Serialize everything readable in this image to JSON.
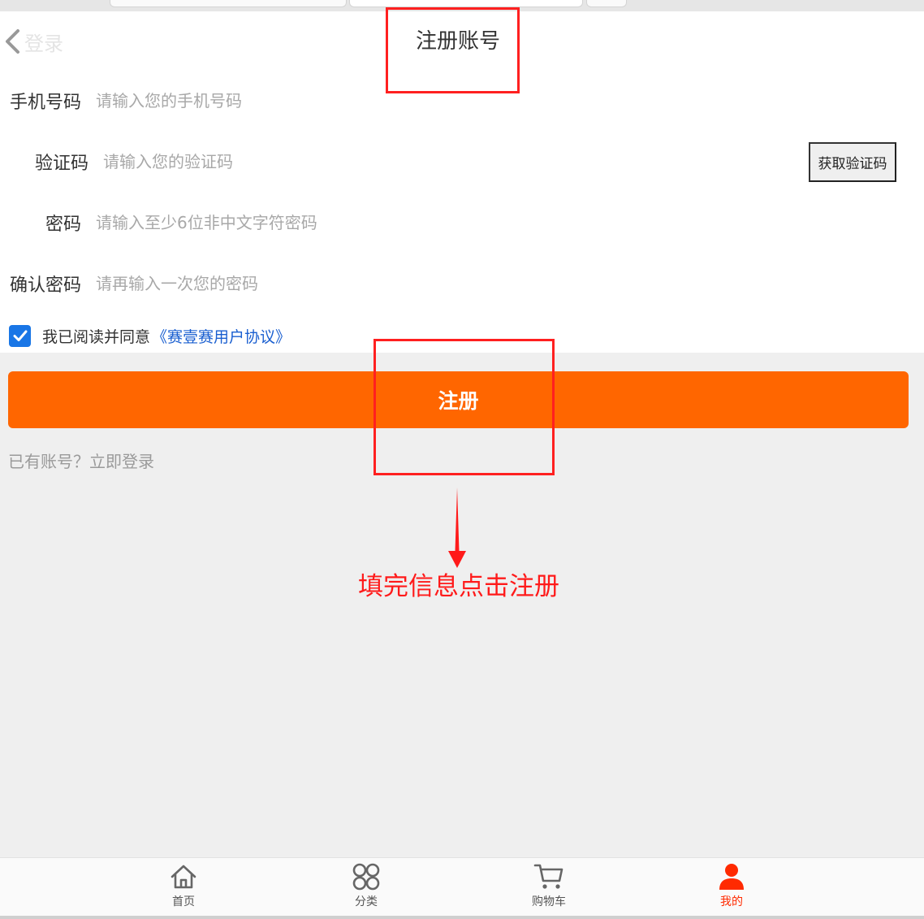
{
  "header": {
    "back_label": "登录",
    "title": "注册账号"
  },
  "form": {
    "phone": {
      "label": "手机号码",
      "placeholder": "请输入您的手机号码",
      "value": ""
    },
    "code": {
      "label": "验证码",
      "placeholder": "请输入您的验证码",
      "value": "",
      "button_label": "获取验证码"
    },
    "password": {
      "label": "密码",
      "placeholder": "请输入至少6位非中文字符密码",
      "value": ""
    },
    "confirm": {
      "label": "确认密码",
      "placeholder": "请再输入一次您的密码",
      "value": ""
    }
  },
  "agreement": {
    "checked": true,
    "text": "我已阅读并同意",
    "link_text": "《赛壹赛用户协议》"
  },
  "register_button_label": "注册",
  "login_link_text": "已有账号？立即登录",
  "annotation": {
    "text": "填完信息点击注册",
    "color": "#ff1a1a"
  },
  "tabbar": {
    "items": [
      {
        "label": "首页",
        "icon": "home-icon",
        "active": false
      },
      {
        "label": "分类",
        "icon": "category-icon",
        "active": false
      },
      {
        "label": "购物车",
        "icon": "cart-icon",
        "active": false
      },
      {
        "label": "我的",
        "icon": "user-icon",
        "active": true
      }
    ]
  },
  "colors": {
    "primary": "#ff6600",
    "active_tab": "#ff2a00",
    "link": "#1a5fd0",
    "checkbox": "#1976e6"
  }
}
